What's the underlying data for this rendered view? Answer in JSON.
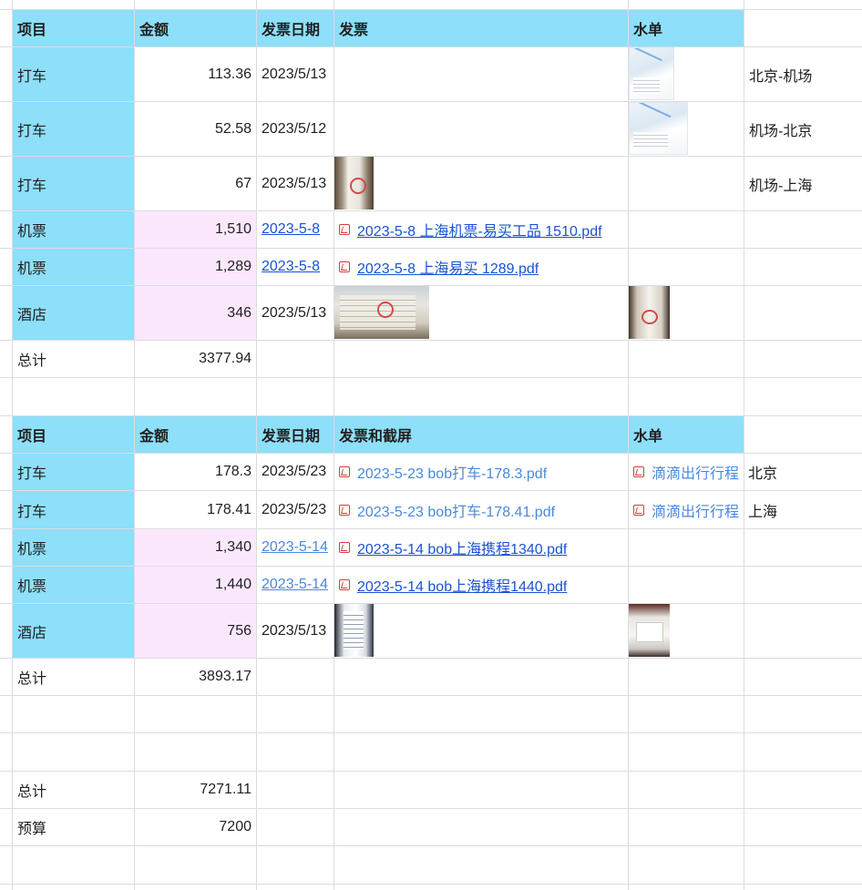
{
  "table1": {
    "headers": [
      "项目",
      "金额",
      "发票日期",
      "发票",
      "水单"
    ],
    "rows": [
      {
        "item": "打车",
        "amount": "113.36",
        "date": "2023/5/13",
        "note": "北京-机场"
      },
      {
        "item": "打车",
        "amount": "52.58",
        "date": "2023/5/12",
        "note": "机场-北京"
      },
      {
        "item": "打车",
        "amount": "67",
        "date": "2023/5/13",
        "note": "机场-上海"
      },
      {
        "item": "机票",
        "amount": "1,510",
        "date": "2023-5-8",
        "invoice_file": "2023-5-8 上海机票-易买工品 1510.pdf"
      },
      {
        "item": "机票",
        "amount": "1,289",
        "date": "2023-5-8",
        "invoice_file": "2023-5-8 上海易买 1289.pdf"
      },
      {
        "item": "酒店",
        "amount": "346",
        "date": "2023/5/13"
      }
    ],
    "total_label": "总计",
    "total": "3377.94"
  },
  "table2": {
    "headers": [
      "项目",
      "金额",
      "发票日期",
      "发票和截屏",
      "水单"
    ],
    "rows": [
      {
        "item": "打车",
        "amount": "178.3",
        "date": "2023/5/23",
        "invoice_file": "2023-5-23 bob打车-178.3.pdf",
        "receipt_file": "滴滴出行行程",
        "note": "北京"
      },
      {
        "item": "打车",
        "amount": "178.41",
        "date": "2023/5/23",
        "invoice_file": "2023-5-23 bob打车-178.41.pdf",
        "receipt_file": "滴滴出行行程",
        "note": "上海"
      },
      {
        "item": "机票",
        "amount": "1,340",
        "date": "2023-5-14",
        "invoice_file": "2023-5-14 bob上海携程1340.pdf"
      },
      {
        "item": "机票",
        "amount": "1,440",
        "date": "2023-5-14",
        "invoice_file": "2023-5-14 bob上海携程1440.pdf"
      },
      {
        "item": "酒店",
        "amount": "756",
        "date": "2023/5/13"
      }
    ],
    "total_label": "总计",
    "total": "3893.17"
  },
  "summary": {
    "total_label": "总计",
    "total": "7271.11",
    "budget_label": "预算",
    "budget": "7200"
  },
  "colors": {
    "header_bg": "#8edff9",
    "amount_highlight": "#fbe8fd",
    "link": "#1a52d6",
    "pdf_icon": "#d63c3c"
  },
  "icons": {
    "pdf": "pdf-file-icon"
  }
}
